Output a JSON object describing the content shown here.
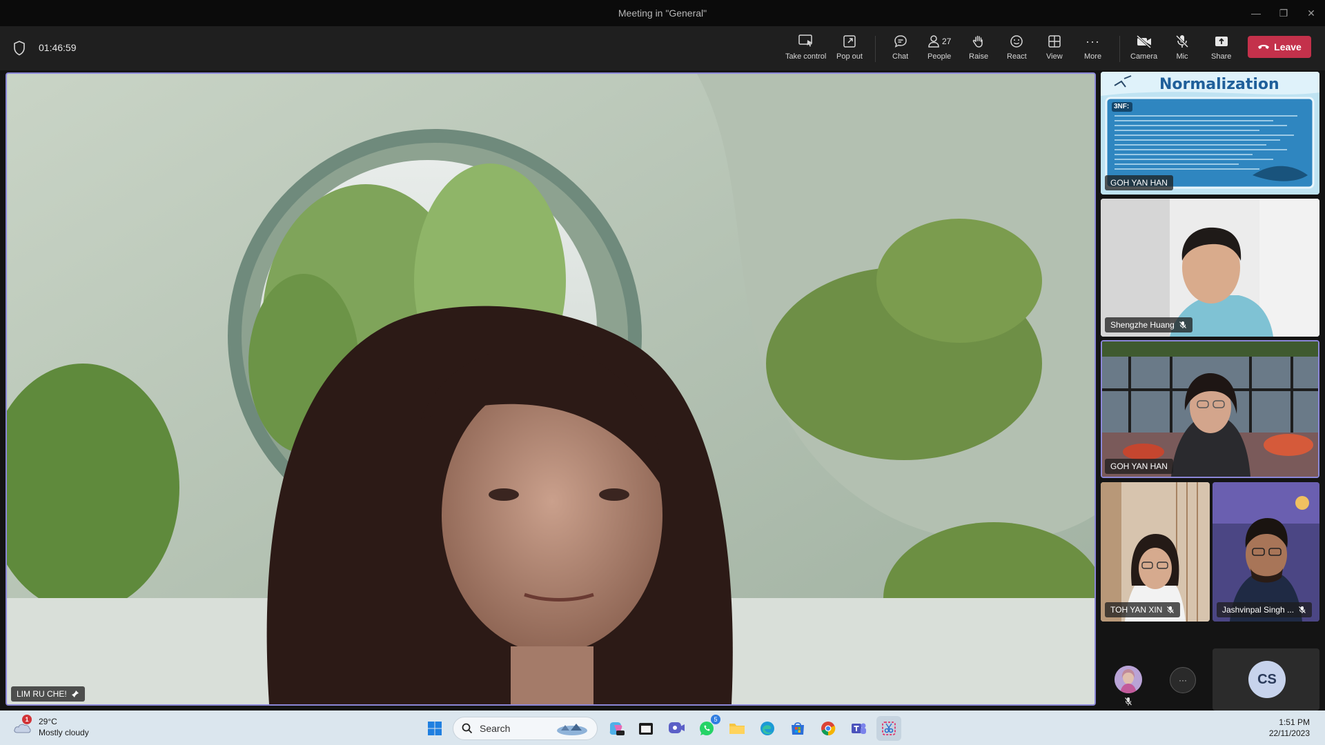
{
  "window": {
    "title": "Meeting in \"General\""
  },
  "meeting": {
    "duration": "01:46:59"
  },
  "toolbar": {
    "take_control": "Take control",
    "pop_out": "Pop out",
    "chat": "Chat",
    "people": "People",
    "people_count": "27",
    "raise": "Raise",
    "react": "React",
    "view": "View",
    "more": "More",
    "camera": "Camera",
    "mic": "Mic",
    "share": "Share",
    "leave": "Leave"
  },
  "main_stage": {
    "speaker_name": "LIM RU CHE!"
  },
  "gallery": {
    "tiles": [
      {
        "name": "GOH YAN HAN",
        "slide_title": "Normalization",
        "slide_tag": "3NF:"
      },
      {
        "name": "Shengzhe Huang"
      },
      {
        "name": "GOH YAN HAN"
      },
      {
        "name": "TOH YAN XIN"
      },
      {
        "name": "Jashvinpal Singh ..."
      }
    ],
    "overflow_label": "···",
    "initials": "CS"
  },
  "taskbar": {
    "weather_temp": "29°C",
    "weather_desc": "Mostly cloudy",
    "weather_badge": "1",
    "search_label": "Search",
    "whatsapp_badge": "5",
    "time": "1:51 PM",
    "date": "22/11/2023"
  },
  "colors": {
    "accent": "#8b87d8",
    "leave": "#c4314b",
    "toolbar_bg": "#1f1f1f",
    "taskbar_bg": "#dbe6ee"
  }
}
